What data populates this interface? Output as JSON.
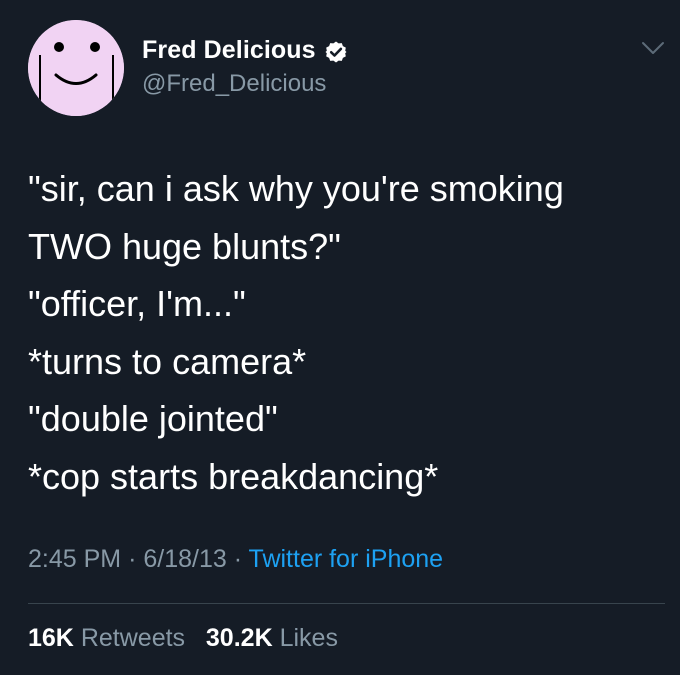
{
  "colors": {
    "background": "#151c26",
    "avatar_bg": "#f1d3f3",
    "verified_badge": "#ffffff",
    "secondary_text": "#8899a6",
    "link": "#1da1f2",
    "divider": "#38444d"
  },
  "icons": {
    "avatar": "cartoon-face-avatar",
    "verified": "verified-badge-icon",
    "menu": "chevron-down-icon"
  },
  "user": {
    "display_name": "Fred Delicious",
    "handle": "@Fred_Delicious"
  },
  "tweet": {
    "lines": [
      "\"sir, can i ask why you're smoking",
      "TWO huge blunts?\"",
      "\"officer, I'm...\"",
      "*turns to camera*",
      "\"double jointed\"",
      "*cop starts breakdancing*"
    ],
    "time": "2:45 PM",
    "date": "6/18/13",
    "separator": "·",
    "source": "Twitter for iPhone"
  },
  "stats": {
    "retweets_count": "16K",
    "retweets_label": "Retweets",
    "likes_count": "30.2K",
    "likes_label": "Likes"
  }
}
